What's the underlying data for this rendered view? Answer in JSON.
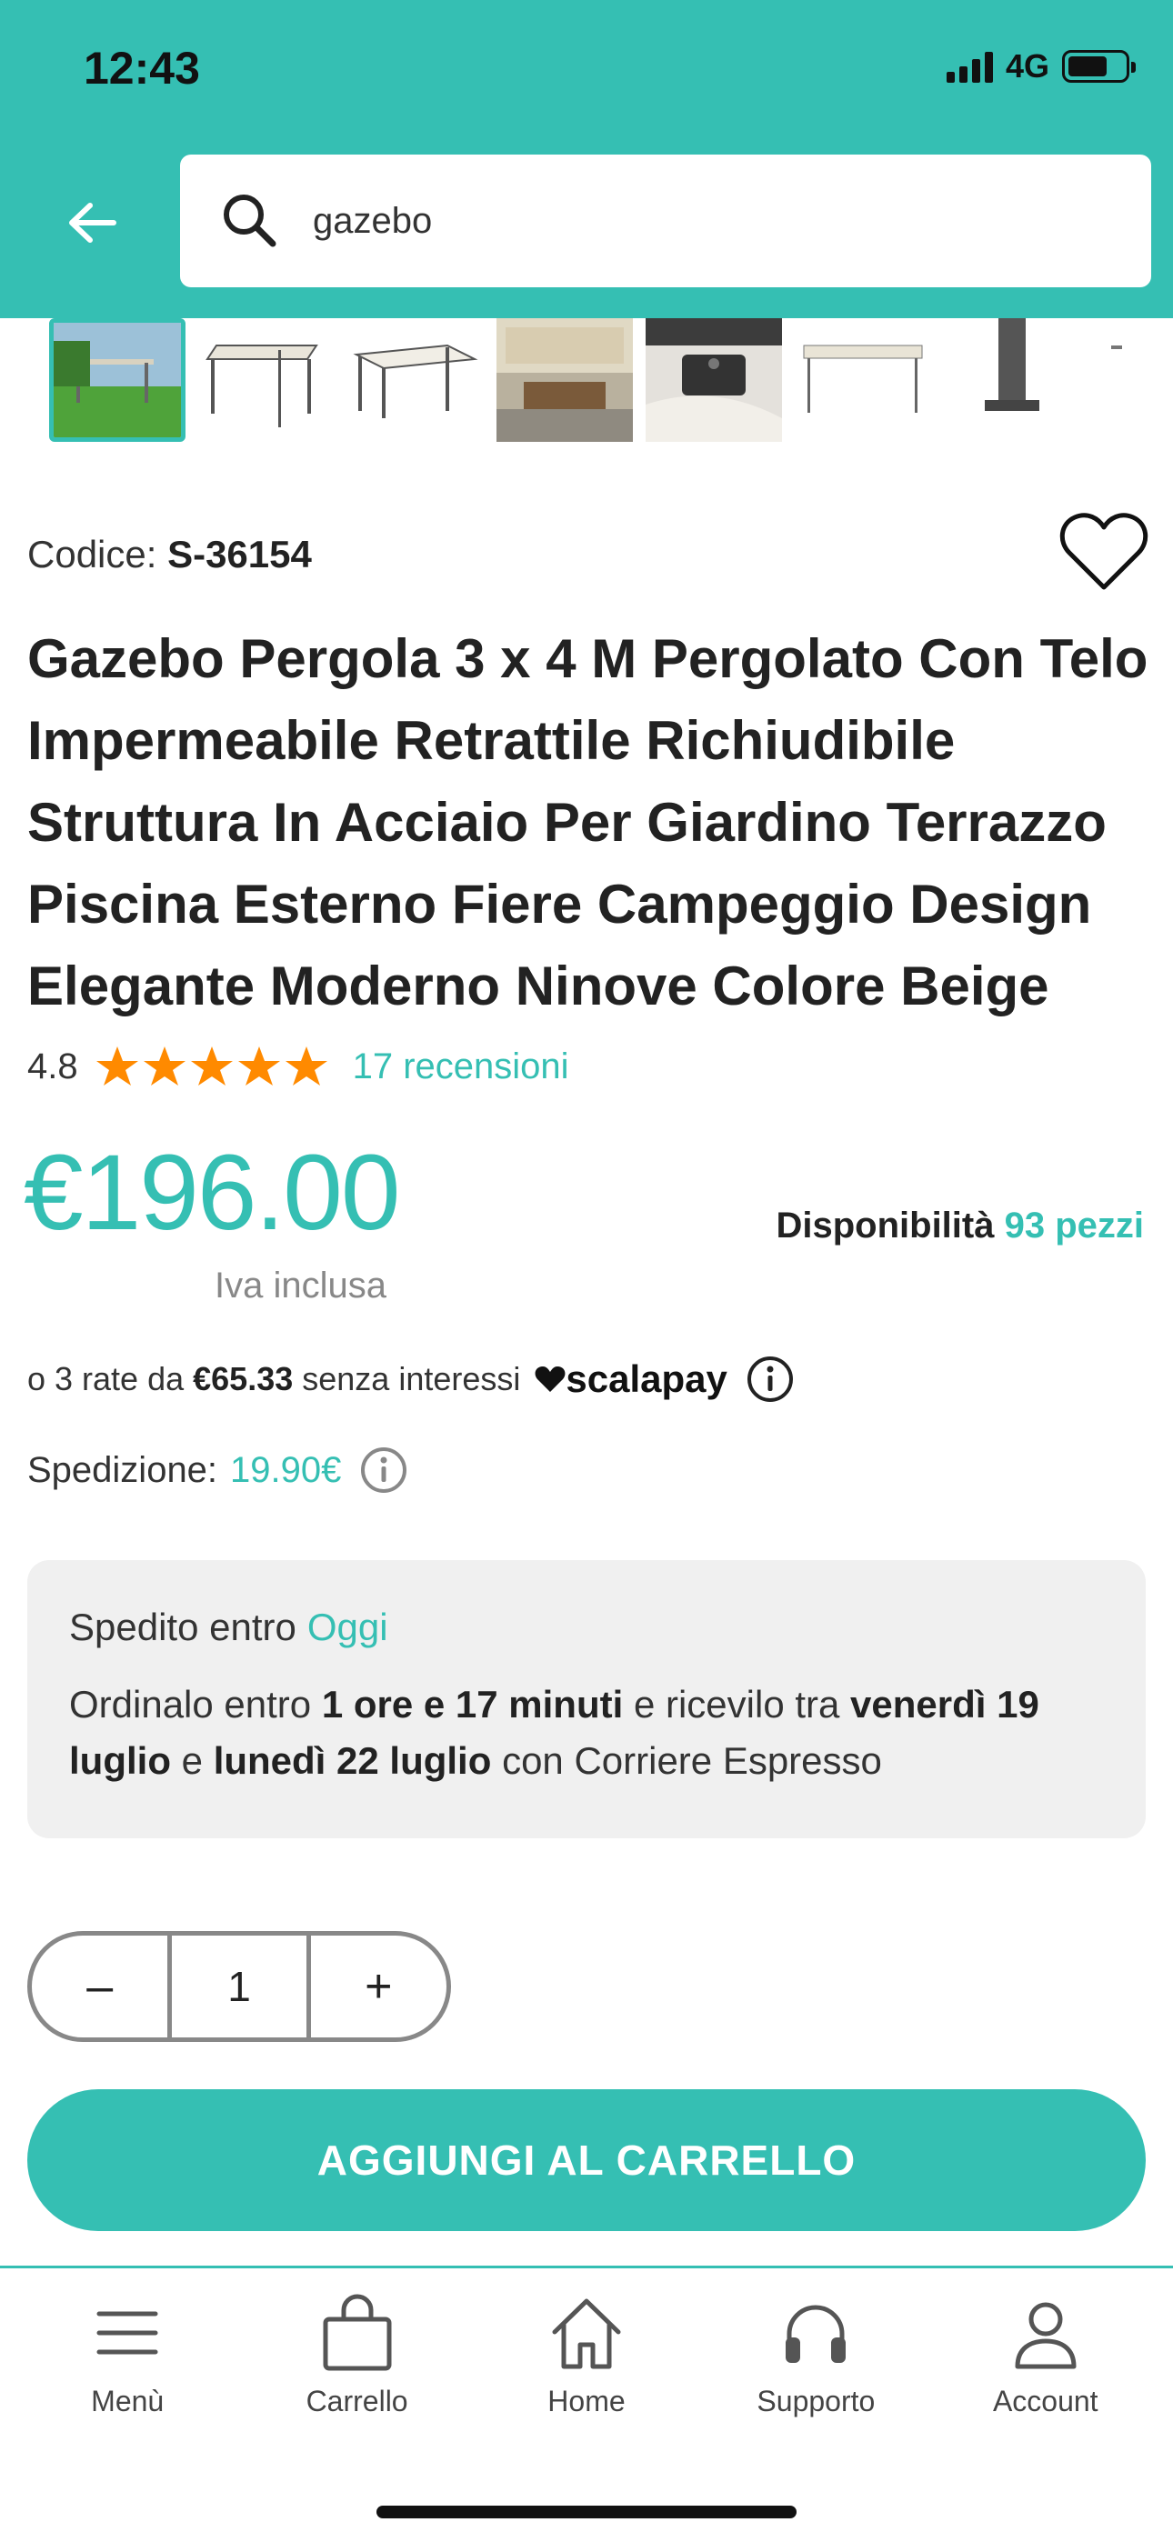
{
  "status_bar": {
    "time": "12:43",
    "network": "4G"
  },
  "search": {
    "value": "gazebo"
  },
  "product": {
    "code_label": "Codice:",
    "code_value": "S-36154",
    "title": "Gazebo Pergola 3 x 4 M Pergolato Con Telo Impermeabile Retrattile Richiudibile Struttura In Acciaio Per Giardino Terrazzo Piscina Esterno Fiere Campeggio Design Elegante Moderno Ninove Colore Beige",
    "rating": "4.8",
    "rating_stars": 5,
    "reviews": "17 recensioni",
    "price": "€196.00",
    "vat": "Iva inclusa",
    "availability_label": "Disponibilità",
    "availability_qty": "93 pezzi"
  },
  "installments": {
    "prefix": "o 3 rate da",
    "amount": "€65.33",
    "suffix": "senza interessi",
    "brand": "scalapay"
  },
  "shipping": {
    "label": "Spedizione:",
    "cost": "19.90€"
  },
  "delivery": {
    "sent_label": "Spedito entro",
    "sent_value": "Oggi",
    "order_1": "Ordinalo entro",
    "order_time": "1 ore e 17 minuti",
    "order_2": "e ricevilo tra",
    "date_1": "venerdì 19 luglio",
    "order_3": "e",
    "date_2": "lunedì 22 luglio",
    "order_4": "con Corriere Espresso"
  },
  "quantity": {
    "minus": "–",
    "value": "1",
    "plus": "+"
  },
  "add_to_cart": "AGGIUNGI AL CARRELLO",
  "nav": [
    {
      "label": "Menù",
      "icon": "menu-icon"
    },
    {
      "label": "Carrello",
      "icon": "cart-icon"
    },
    {
      "label": "Home",
      "icon": "home-icon"
    },
    {
      "label": "Supporto",
      "icon": "headset-icon"
    },
    {
      "label": "Account",
      "icon": "user-icon"
    }
  ],
  "colors": {
    "accent": "#35bfb3",
    "star": "#ff8a00"
  }
}
